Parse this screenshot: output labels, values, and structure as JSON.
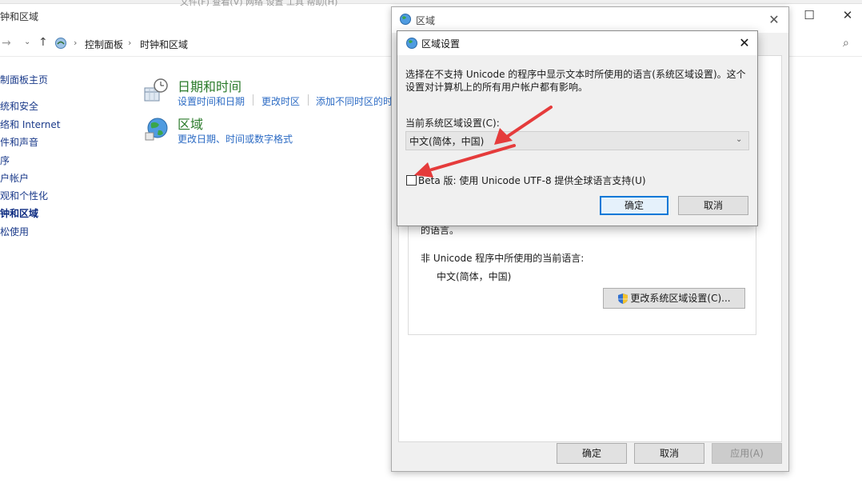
{
  "explorer": {
    "title": "钟和区域",
    "menu_strip": "文件(F)  查看(V)  网络  设置  工具  帮助(H)",
    "window_controls": {
      "minimize": "—",
      "maximize": "☐",
      "close": "✕"
    },
    "nav": {
      "back": "→",
      "forward": "⌄",
      "up": "↑",
      "sep": "›",
      "search_icon": "⌕"
    },
    "breadcrumb": [
      "控制面板",
      "时钟和区域"
    ],
    "sidebar": [
      {
        "label": "制面板主页"
      },
      {
        "label": "统和安全"
      },
      {
        "label": "络和 Internet"
      },
      {
        "label": "件和声音"
      },
      {
        "label": "序"
      },
      {
        "label": "户帐户"
      },
      {
        "label": "观和个性化"
      },
      {
        "label": "钟和区域"
      },
      {
        "label": "松使用"
      }
    ],
    "categories": {
      "datetime": {
        "title": "日期和时间",
        "links": [
          "设置时间和日期",
          "更改时区",
          "添加不同时区的时"
        ]
      },
      "region": {
        "title": "区域",
        "link": "更改日期、时间或数字格式"
      }
    }
  },
  "region_dialog": {
    "title": "区域",
    "close": "✕",
    "partial_text": "的语言。",
    "nonunicode_label": "非 Unicode 程序中所使用的当前语言:",
    "nonunicode_value": "中文(简体，中国)",
    "change_locale_button": "更改系统区域设置(C)...",
    "buttons": {
      "ok": "确定",
      "cancel": "取消",
      "apply": "应用(A)"
    }
  },
  "locale_dialog": {
    "title": "区域设置",
    "close": "✕",
    "description": "选择在不支持 Unicode 的程序中显示文本时所使用的语言(系统区域设置)。这个设置对计算机上的所有用户帐户都有影响。",
    "current_label": "当前系统区域设置(C):",
    "current_value": "中文(简体，中国)",
    "chevron": "⌄",
    "beta_label": "Beta 版: 使用 Unicode UTF-8 提供全球语言支持(U)",
    "beta_checked": false,
    "ok": "确定",
    "cancel": "取消"
  },
  "colors": {
    "link": "#2c6bc4",
    "category_title": "#2a7a2a",
    "annotation_arrow": "#e53b3b",
    "accent": "#0078d7"
  },
  "icons": [
    "control-panel-icon",
    "clock-calendar-icon",
    "globe-icon",
    "shield-icon",
    "search-icon"
  ]
}
